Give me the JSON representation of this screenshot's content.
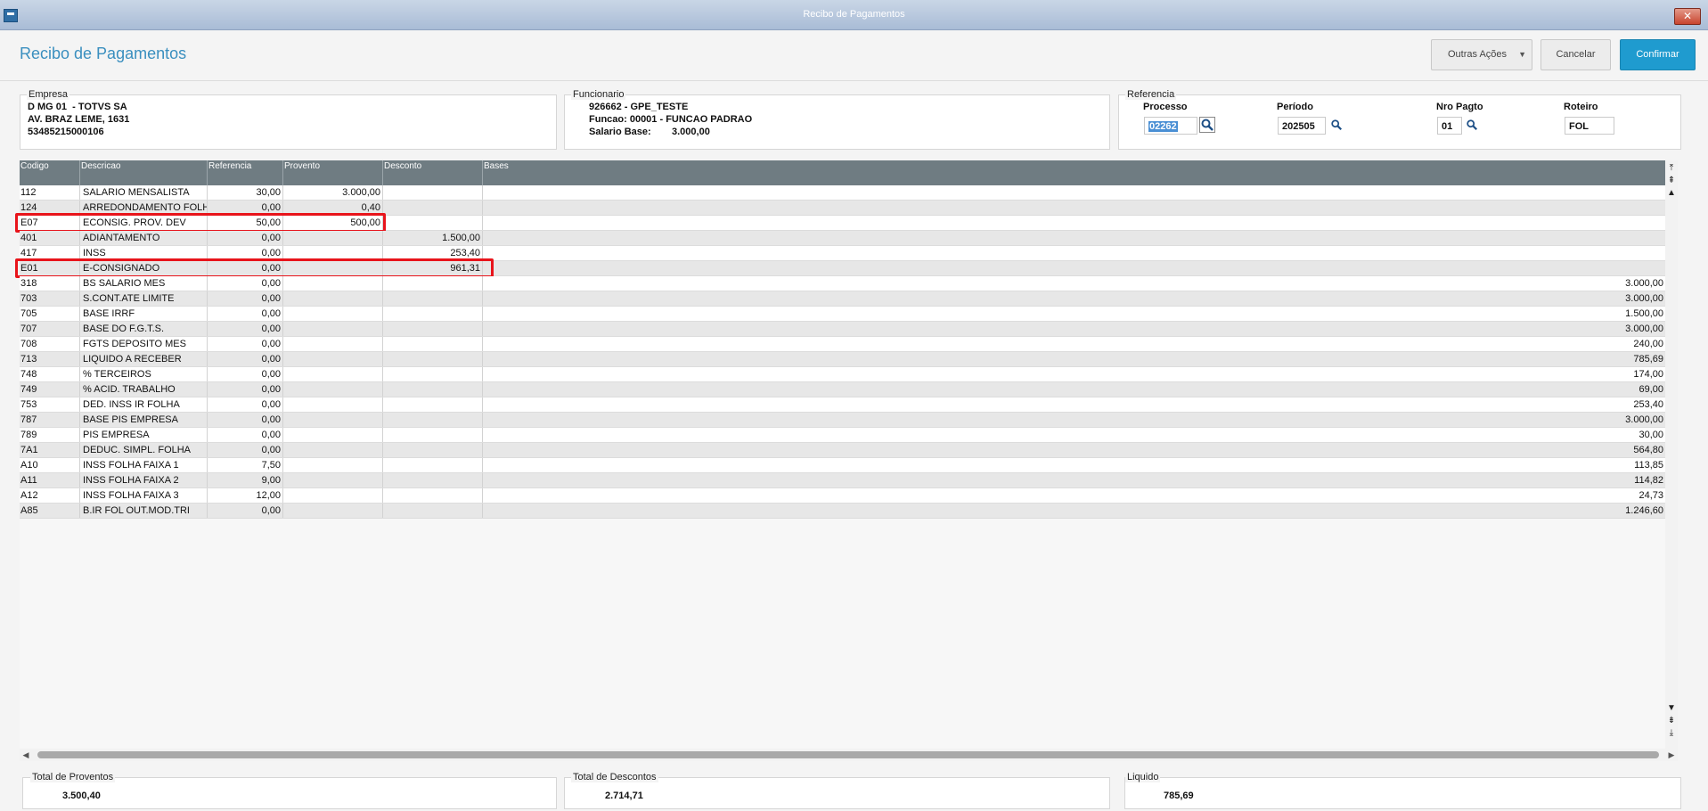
{
  "window": {
    "title": "Recibo de Pagamentos",
    "close": "✕"
  },
  "header": {
    "title": "Recibo de Pagamentos",
    "outras_acoes": "Outras Ações",
    "cancelar": "Cancelar",
    "confirmar": "Confirmar"
  },
  "empresa": {
    "legend": "Empresa",
    "line1": "D MG 01  - TOTVS SA",
    "line2": "AV. BRAZ LEME, 1631",
    "line3": "53485215000106"
  },
  "funcionario": {
    "legend": "Funcionario",
    "line1": "926662 - GPE_TESTE",
    "line2": "Funcao: 00001 - FUNCAO PADRAO",
    "salario_label": "Salario Base:",
    "salario_value": "3.000,00"
  },
  "referencia": {
    "legend": "Referencia",
    "processo_label": "Processo",
    "processo_value": "02262",
    "periodo_label": "Período",
    "periodo_value": "202505",
    "nro_pagto_label": "Nro Pagto",
    "nro_pagto_value": "01",
    "roteiro_label": "Roteiro",
    "roteiro_value": "FOL"
  },
  "grid": {
    "columns": [
      "Codigo",
      "Descricao",
      "Referencia",
      "Provento",
      "Desconto",
      "Bases"
    ],
    "rows": [
      {
        "codigo": "112",
        "descricao": "SALARIO MENSALISTA",
        "referencia": "30,00",
        "provento": "3.000,00",
        "desconto": "",
        "bases": ""
      },
      {
        "codigo": "124",
        "descricao": "ARREDONDAMENTO FOLH",
        "referencia": "0,00",
        "provento": "0,40",
        "desconto": "",
        "bases": ""
      },
      {
        "codigo": "E07",
        "descricao": "ECONSIG. PROV. DEV",
        "referencia": "50,00",
        "provento": "500,00",
        "desconto": "",
        "bases": ""
      },
      {
        "codigo": "401",
        "descricao": "ADIANTAMENTO",
        "referencia": "0,00",
        "provento": "",
        "desconto": "1.500,00",
        "bases": ""
      },
      {
        "codigo": "417",
        "descricao": "INSS",
        "referencia": "0,00",
        "provento": "",
        "desconto": "253,40",
        "bases": ""
      },
      {
        "codigo": "E01",
        "descricao": "E-CONSIGNADO",
        "referencia": "0,00",
        "provento": "",
        "desconto": "961,31",
        "bases": ""
      },
      {
        "codigo": "318",
        "descricao": "BS SALARIO MES",
        "referencia": "0,00",
        "provento": "",
        "desconto": "",
        "bases": "3.000,00"
      },
      {
        "codigo": "703",
        "descricao": "S.CONT.ATE LIMITE",
        "referencia": "0,00",
        "provento": "",
        "desconto": "",
        "bases": "3.000,00"
      },
      {
        "codigo": "705",
        "descricao": "BASE IRRF",
        "referencia": "0,00",
        "provento": "",
        "desconto": "",
        "bases": "1.500,00"
      },
      {
        "codigo": "707",
        "descricao": "BASE DO F.G.T.S.",
        "referencia": "0,00",
        "provento": "",
        "desconto": "",
        "bases": "3.000,00"
      },
      {
        "codigo": "708",
        "descricao": "FGTS DEPOSITO MES",
        "referencia": "0,00",
        "provento": "",
        "desconto": "",
        "bases": "240,00"
      },
      {
        "codigo": "713",
        "descricao": "LIQUIDO A RECEBER",
        "referencia": "0,00",
        "provento": "",
        "desconto": "",
        "bases": "785,69"
      },
      {
        "codigo": "748",
        "descricao": "% TERCEIROS",
        "referencia": "0,00",
        "provento": "",
        "desconto": "",
        "bases": "174,00"
      },
      {
        "codigo": "749",
        "descricao": "% ACID. TRABALHO",
        "referencia": "0,00",
        "provento": "",
        "desconto": "",
        "bases": "69,00"
      },
      {
        "codigo": "753",
        "descricao": "DED. INSS IR FOLHA",
        "referencia": "0,00",
        "provento": "",
        "desconto": "",
        "bases": "253,40"
      },
      {
        "codigo": "787",
        "descricao": "BASE PIS EMPRESA",
        "referencia": "0,00",
        "provento": "",
        "desconto": "",
        "bases": "3.000,00"
      },
      {
        "codigo": "789",
        "descricao": "PIS EMPRESA",
        "referencia": "0,00",
        "provento": "",
        "desconto": "",
        "bases": "30,00"
      },
      {
        "codigo": "7A1",
        "descricao": "DEDUC. SIMPL. FOLHA",
        "referencia": "0,00",
        "provento": "",
        "desconto": "",
        "bases": "564,80"
      },
      {
        "codigo": "A10",
        "descricao": "INSS FOLHA FAIXA 1",
        "referencia": "7,50",
        "provento": "",
        "desconto": "",
        "bases": "113,85"
      },
      {
        "codigo": "A11",
        "descricao": "INSS FOLHA FAIXA 2",
        "referencia": "9,00",
        "provento": "",
        "desconto": "",
        "bases": "114,82"
      },
      {
        "codigo": "A12",
        "descricao": "INSS FOLHA FAIXA 3",
        "referencia": "12,00",
        "provento": "",
        "desconto": "",
        "bases": "24,73"
      },
      {
        "codigo": "A85",
        "descricao": "B.IR FOL OUT.MOD.TRI",
        "referencia": "0,00",
        "provento": "",
        "desconto": "",
        "bases": "1.246,60"
      }
    ],
    "highlighted_rows": [
      "E07",
      "E01"
    ],
    "highlight_color": "#e8141b"
  },
  "totais": {
    "proventos_label": "Total de Proventos",
    "proventos_value": "3.500,40",
    "descontos_label": "Total de Descontos",
    "descontos_value": "2.714,71",
    "liquido_label": "Liquido",
    "liquido_value": "785,69"
  },
  "colors": {
    "accent": "#1f9bcf",
    "title": "#3a8fbf",
    "grid_header": "#6f7c82"
  }
}
